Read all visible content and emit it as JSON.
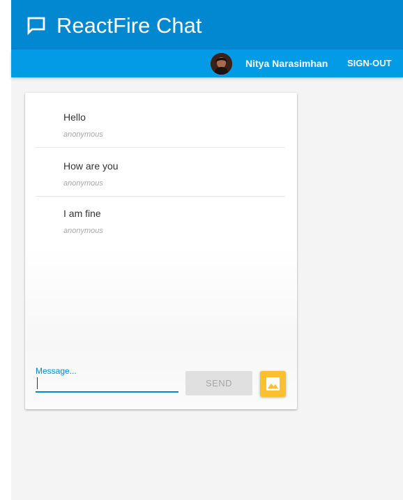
{
  "header": {
    "title": "ReactFire Chat",
    "icon": "chat-bubble-icon"
  },
  "user_bar": {
    "user_name": "Nitya Narasimhan",
    "sign_out_label": "SIGN-OUT"
  },
  "messages": [
    {
      "text": "Hello",
      "author": "anonymous"
    },
    {
      "text": "How are you",
      "author": "anonymous"
    },
    {
      "text": "I am fine",
      "author": "anonymous"
    }
  ],
  "composer": {
    "label": "Message...",
    "value": "",
    "send_label": "SEND",
    "image_icon": "image-icon"
  },
  "colors": {
    "header": "#0288d1",
    "user_bar": "#039be5",
    "accent": "#fbc02d"
  }
}
